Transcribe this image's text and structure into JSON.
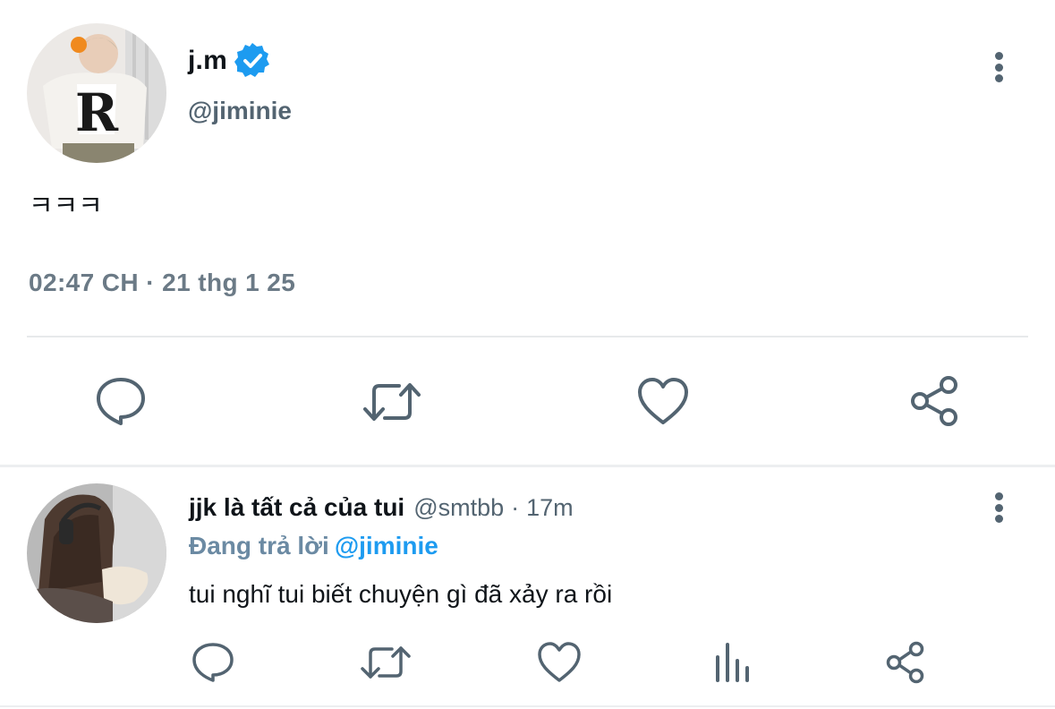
{
  "main_tweet": {
    "display_name": "j.m",
    "verified": true,
    "handle": "@jiminie",
    "text": "ㅋㅋㅋ",
    "timestamp": "02:47 CH · 21 thg 1 25",
    "avatar_icon": "avatar-photo",
    "actions": [
      "reply-icon",
      "retweet-icon",
      "like-icon",
      "share-icon"
    ]
  },
  "reply": {
    "display_name": "jjk là tất cả của tui",
    "handle": "@smtbb",
    "separator": "·",
    "time": "17m",
    "replying_prefix": "Đang trả lời",
    "replying_to": "@jiminie",
    "text": "tui nghĩ tui biết chuyện gì đã xảy ra rồi",
    "avatar_icon": "avatar-photo",
    "actions": [
      "reply-icon",
      "retweet-icon",
      "like-icon",
      "analytics-icon",
      "share-icon"
    ]
  },
  "colors": {
    "icon_gray": "#536471",
    "text_primary": "#0f1419",
    "verified_blue": "#1d9bf0",
    "link_blue": "#1d9bf0"
  }
}
